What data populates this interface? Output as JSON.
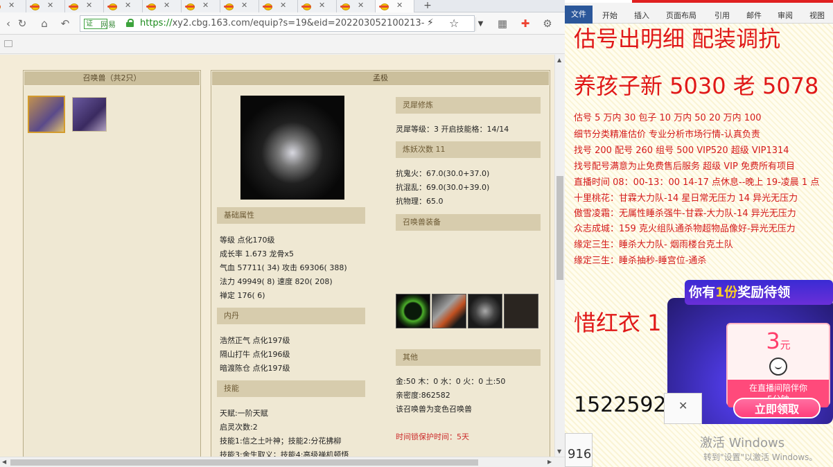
{
  "browser": {
    "tab_count": 11,
    "address": {
      "cert_label": "证",
      "site_name": "网易",
      "protocol": "https://",
      "host_path": "xy2.cbg.163.com/equip?s=19&eid=202203052100213-"
    }
  },
  "pets_panel": {
    "title": "召唤兽（共2只）"
  },
  "detail_panel": {
    "title": "孟极",
    "base_section": "基础属性",
    "base_lines": [
      "等级  点化170级",
      "成长率  1.673  龙骨x5",
      "气血  57711( 34) 攻击  69306( 388)",
      "法力  49949( 8) 速度  820( 208)",
      "禅定  176( 6)"
    ],
    "neidan_section": "内丹",
    "neidan_lines": [
      "浩然正气  点化197级",
      "隔山打牛  点化196级",
      "暗渡陈仓  点化197级"
    ],
    "skill_section": "技能",
    "skill_lines": [
      "天赋:一阶天赋",
      "启灵次数:2",
      "技能1:信之土叶神；技能2:分花拂柳",
      "技能3:舍生取义；技能4:高级禅机顿悟"
    ],
    "lingxi_section": "灵犀修炼",
    "lingxi_line": "灵犀等级：3     开启技能格：14/14",
    "lianyao_section": "炼妖次数  11",
    "resist_lines": [
      "抗鬼火：67.0(30.0+37.0)",
      "抗混乱：69.0(30.0+39.0)",
      "抗物理：65.0"
    ],
    "equip_section": "召唤兽装备",
    "other_section": "其他",
    "other_lines": [
      "金:50  木：0  水：0  火：0  土:50",
      "亲密度:862582",
      "该召唤兽为变色召唤兽"
    ],
    "lock_text": "时间锁保护时间：5天"
  },
  "word": {
    "ribbon_tabs": [
      "文件",
      "开始",
      "插入",
      "页面布局",
      "引用",
      "邮件",
      "审阅",
      "视图"
    ],
    "heading1": "估号出明细  配装调抗",
    "heading2": "养孩子新  5030  老  5078",
    "lines": [
      "估号 5 万内 30 包子   10 万内 50  20 万内 100",
      "细节分类精准估价   专业分析市场行情-认真负责",
      "找号 200     配号 260     组号 500 VIP520     超级 VIP1314",
      "找号配号满意为止免费售后服务     超级 VIP 免费所有项目",
      "直播时间 08：00-13：00  14-17 点休息--晚上 19-凌晨 1 点",
      "十里桃花：甘霖大力队-14 星日常无压力 14 异光无压力",
      "傲雪凌霜：无属性睡杀强牛-甘霖-大力队-14 异光无压力",
      "众志成城：159 克火组队通杀物超物品像好-异光无压力",
      "缘定三生：睡杀大力队-      烟雨楼台克土队",
      "缘定三生：睡杀抽秒-睡宫位-通杀"
    ],
    "heading3": "惜红衣  1",
    "phone": "1522592",
    "small_box_text": "916"
  },
  "popup": {
    "head_pre": "你有",
    "head_num": "1份",
    "head_post": "奖励待领",
    "amount": "3",
    "unit": "元",
    "envelope_line1": "在直播间陪伴你",
    "envelope_line2": "5分钟",
    "claim_label": "立即领取"
  },
  "watermark": {
    "line1": "激活 Windows",
    "line2": "转到\"设置\"以激活 Windows。"
  }
}
